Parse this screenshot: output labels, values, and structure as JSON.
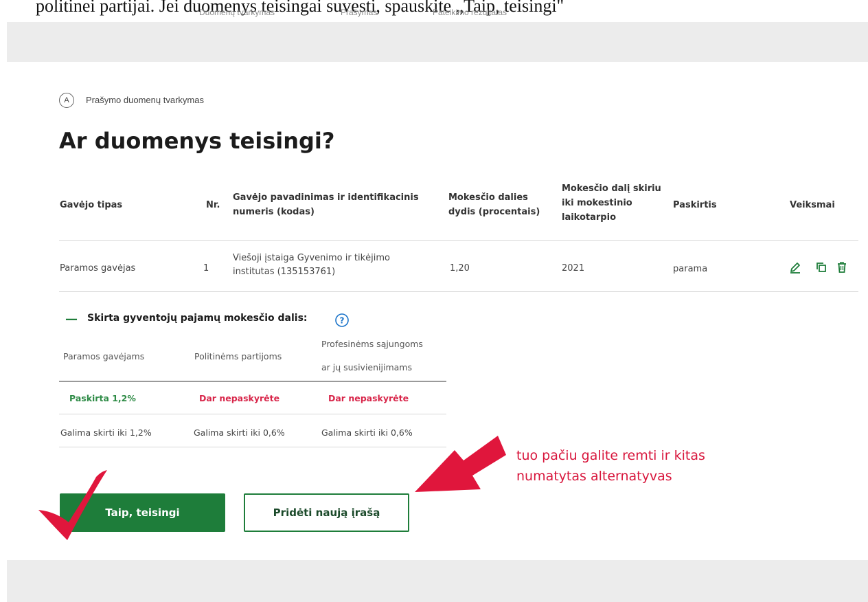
{
  "caption": {
    "text": "politinei partijai. Jei duomenys teisingai suvesti, spauskite „Taip, teisingi\""
  },
  "stepper": {
    "steps": [
      "Duomenų tvarkymas",
      "Prašymas",
      "Pateikimo rezultatas"
    ]
  },
  "section": {
    "badge": "A",
    "label": "Prašymo duomenų tvarkymas"
  },
  "page": {
    "title": "Ar duomenys teisingi?"
  },
  "table": {
    "headers": {
      "type": "Gavėjo tipas",
      "nr": "Nr.",
      "name_l1": "Gavėjo pavadinimas ir identifikacinis",
      "name_l2": "numeris (kodas)",
      "share_l1": "Mokesčio dalies",
      "share_l2": "dydis (procentais)",
      "period_l1": "Mokesčio dalį skiriu",
      "period_l2": "iki mokestinio",
      "period_l3": "laikotarpio",
      "purpose": "Paskirtis",
      "actions": "Veiksmai"
    },
    "rows": [
      {
        "type": "Paramos gavėjas",
        "nr": "1",
        "name_l1": "Viešoji įstaiga Gyvenimo ir tikėjimo",
        "name_l2": "institutas (135153761)",
        "share": "1,20",
        "period": "2021",
        "purpose": "parama"
      }
    ],
    "action_icons": [
      "edit-icon",
      "copy-icon",
      "trash-icon"
    ]
  },
  "summary": {
    "toggle": "—",
    "title": "Skirta gyventojų pajamų mokesčio dalis:",
    "headers": {
      "col1": "Paramos gavėjams",
      "col2": "Politinėms partijoms",
      "col3_l1": "Profesinėms sąjungoms",
      "col3_l2": "ar jų susivienijimams"
    },
    "status_row": {
      "col1": "Paskirta 1,2%",
      "col2": "Dar nepaskyrėte",
      "col3": "Dar nepaskyrėte"
    },
    "limit_row": {
      "col1": "Galima skirti iki 1,2%",
      "col2": "Galima skirti iki 0,6%",
      "col3": "Galima skirti iki 0,6%"
    }
  },
  "buttons": {
    "confirm": "Taip, teisingi",
    "add": "Pridėti naują įrašą"
  },
  "annotation": {
    "line1": "tuo pačiu galite remti ir kitas",
    "line2": "numatytas alternatyvas"
  },
  "colors": {
    "primary_green": "#1e7d3a",
    "accent_red": "#d8163c",
    "band_grey": "#ececec"
  }
}
